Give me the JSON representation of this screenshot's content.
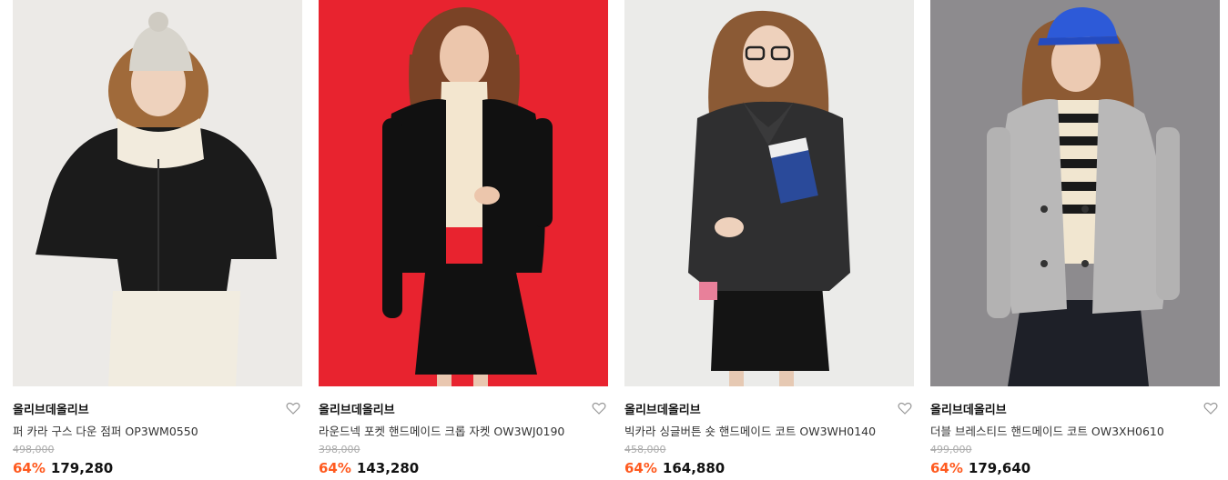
{
  "products": [
    {
      "brand": "올리브데올리브",
      "name": "퍼 카라 구스 다운 점퍼 OP3WM0550",
      "original_price": "498,000",
      "discount": "64%",
      "price": "179,280",
      "bg_color": "#eceae7"
    },
    {
      "brand": "올리브데올리브",
      "name": "라운드넥 포켓 핸드메이드 크롭 자켓 OW3WJ0190",
      "original_price": "398,000",
      "discount": "64%",
      "price": "143,280",
      "bg_color": "#e8232f"
    },
    {
      "brand": "올리브데올리브",
      "name": "빅카라 싱글버튼 숏 핸드메이드 코트 OW3WH0140",
      "original_price": "458,000",
      "discount": "64%",
      "price": "164,880",
      "bg_color": "#ebebe9"
    },
    {
      "brand": "올리브데올리브",
      "name": "더블 브레스티드 핸드메이드 코트 OW3XH0610",
      "original_price": "499,000",
      "discount": "64%",
      "price": "179,640",
      "bg_color": "#8d8b8e"
    }
  ],
  "colors": {
    "discount": "#ff5a1f",
    "strike": "#aaaaaa"
  }
}
